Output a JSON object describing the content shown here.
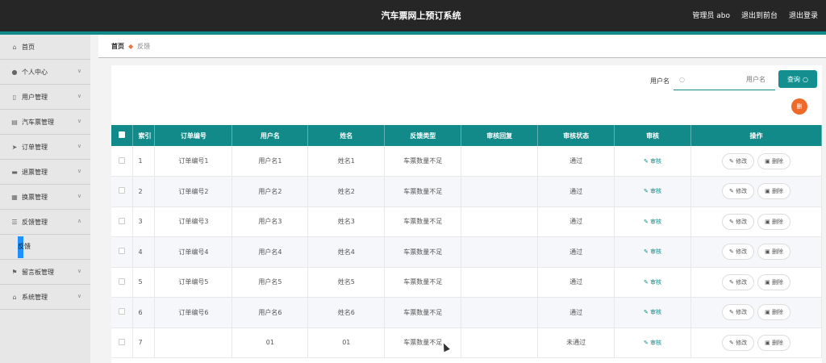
{
  "header": {
    "title": "汽车票网上预订系统",
    "admin": "管理员 abo",
    "exit_front": "退出到前台",
    "logout": "退出登录"
  },
  "sidebar": {
    "items": [
      {
        "label": "首页",
        "icon": "home-icon"
      },
      {
        "label": "个人中心",
        "icon": "user-icon"
      },
      {
        "label": "用户管理",
        "icon": "users-icon"
      },
      {
        "label": "汽车票管理",
        "icon": "ticket-icon"
      },
      {
        "label": "订单管理",
        "icon": "order-icon"
      },
      {
        "label": "退票管理",
        "icon": "refund-icon"
      },
      {
        "label": "换票管理",
        "icon": "exchange-icon"
      },
      {
        "label": "反馈管理",
        "icon": "feedback-icon"
      },
      {
        "label": "留言板管理",
        "icon": "message-icon"
      },
      {
        "label": "系统管理",
        "icon": "system-icon"
      }
    ],
    "sub_item": "反馈"
  },
  "breadcrumb": {
    "home": "首页",
    "current": "反馈"
  },
  "search": {
    "label": "用户名",
    "placeholder": "用户名",
    "button": "查询"
  },
  "delete_button": "删",
  "table": {
    "headers": [
      "索引",
      "订单编号",
      "用户名",
      "姓名",
      "反馈类型",
      "审核回复",
      "审核状态",
      "审核",
      "操作"
    ],
    "rows": [
      {
        "idx": "1",
        "order": "订单编号1",
        "user": "用户名1",
        "name": "姓名1",
        "type": "车票数量不足",
        "reply": "",
        "status": "通过"
      },
      {
        "idx": "2",
        "order": "订单编号2",
        "user": "用户名2",
        "name": "姓名2",
        "type": "车票数量不足",
        "reply": "",
        "status": "通过"
      },
      {
        "idx": "3",
        "order": "订单编号3",
        "user": "用户名3",
        "name": "姓名3",
        "type": "车票数量不足",
        "reply": "",
        "status": "通过"
      },
      {
        "idx": "4",
        "order": "订单编号4",
        "user": "用户名4",
        "name": "姓名4",
        "type": "车票数量不足",
        "reply": "",
        "status": "通过"
      },
      {
        "idx": "5",
        "order": "订单编号5",
        "user": "用户名5",
        "name": "姓名5",
        "type": "车票数量不足",
        "reply": "",
        "status": "通过"
      },
      {
        "idx": "6",
        "order": "订单编号6",
        "user": "用户名6",
        "name": "姓名6",
        "type": "车票数量不足",
        "reply": "",
        "status": "通过"
      },
      {
        "idx": "7",
        "order": "",
        "user": "01",
        "name": "01",
        "type": "车票数量不足",
        "reply": "",
        "status": "未通过"
      }
    ],
    "audit_label": "审核",
    "edit_label": "修改",
    "delete_label": "删除"
  }
}
